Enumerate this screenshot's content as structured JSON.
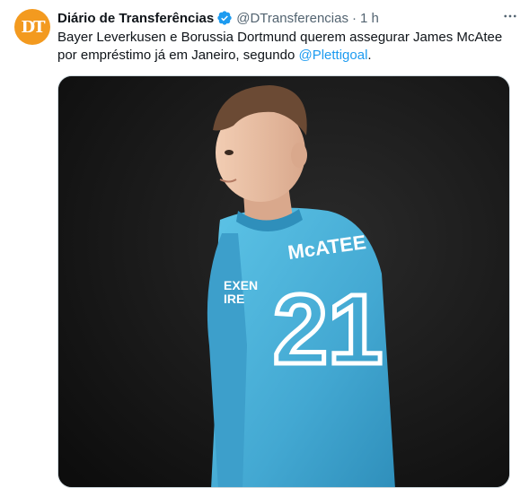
{
  "tweet": {
    "author_name": "Diário de Transferências",
    "handle": "@DTransferencias",
    "separator": "·",
    "time": "1 h",
    "text_before": "Bayer Leverkusen e Borussia Dortmund querem assegurar James McAtee por empréstimo já em Janeiro, segundo ",
    "mention": "@Plettigoal",
    "text_after": ".",
    "avatar_icon": "dt-logo-icon",
    "verified_icon": "verified-badge-icon",
    "more_icon": "more-options-icon"
  },
  "media": {
    "jersey_name": "McATEE",
    "jersey_number": "21",
    "sponsor_line1": "EXEN",
    "sponsor_line2": "IRE",
    "colors": {
      "jersey": "#4fb3d9",
      "background": "#151515",
      "accent": "#1d9bf0",
      "avatar": "#f39a1f"
    }
  }
}
